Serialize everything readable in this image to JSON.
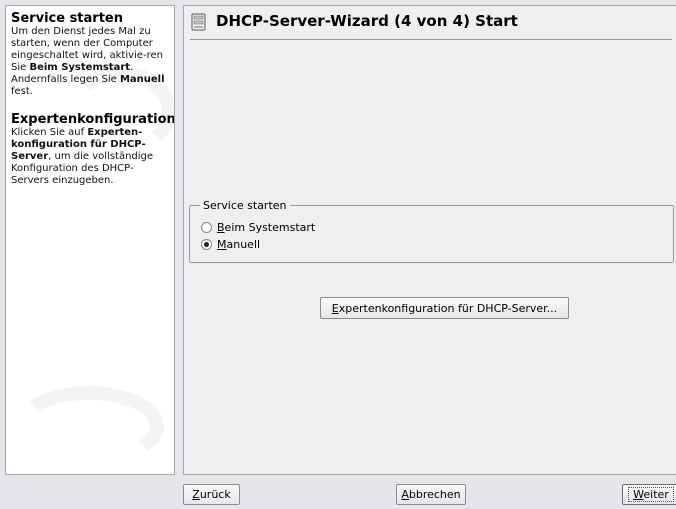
{
  "help": {
    "heading1": "Service starten",
    "para1_a": "Um den Dienst jedes Mal zu starten, wenn der Computer eingeschaltet wird, aktivie-ren Sie ",
    "para1_b": "Beim Systemstart",
    "para1_c": ". Andernfalls legen Sie ",
    "para1_d": "Manuell",
    "para1_e": " fest.",
    "heading2": "Expertenkonfiguration",
    "para2_a": "Klicken Sie auf ",
    "para2_b": "Experten-konfiguration für DHCP-Server",
    "para2_c": ", um die vollständige Konfiguration des DHCP-Servers einzugeben."
  },
  "header": {
    "title": "DHCP-Server-Wizard (4 von 4) Start",
    "icon": "server-icon"
  },
  "service_group": {
    "legend": "Service starten",
    "options": [
      {
        "accel": "B",
        "rest": "eim Systemstart",
        "checked": false
      },
      {
        "accel": "M",
        "rest": "anuell",
        "checked": true
      }
    ]
  },
  "expert_button": {
    "accel": "E",
    "rest": "xpertenkonfiguration für DHCP-Server..."
  },
  "footer": {
    "back": {
      "accel": "Z",
      "rest": "urück"
    },
    "abort": {
      "accel": "A",
      "rest": "bbrechen"
    },
    "next": {
      "accel": "W",
      "rest": "eiter"
    }
  }
}
